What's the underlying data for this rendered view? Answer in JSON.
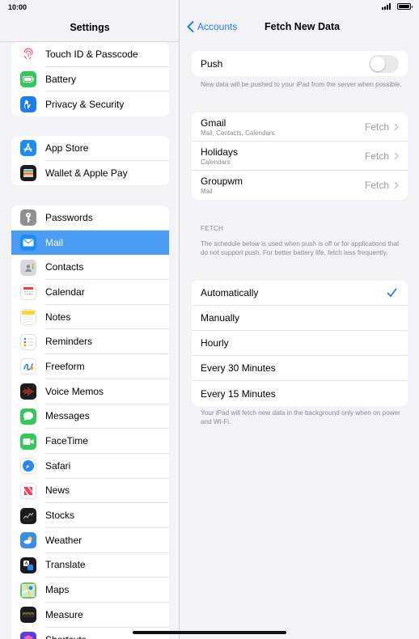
{
  "status": {
    "time": "10:00"
  },
  "sidebar": {
    "title": "Settings",
    "groups": [
      {
        "items": [
          {
            "label": "Touch ID & Passcode",
            "icon": "touch-id-icon",
            "color": "#ffffff"
          },
          {
            "label": "Battery",
            "icon": "battery-icon",
            "color": "#34c759"
          },
          {
            "label": "Privacy & Security",
            "icon": "hand-icon",
            "color": "#1c7cf4"
          }
        ]
      },
      {
        "items": [
          {
            "label": "App Store",
            "icon": "app-store-icon",
            "color": "#1c8cf4"
          },
          {
            "label": "Wallet & Apple Pay",
            "icon": "wallet-icon",
            "color": "#1c1c1e"
          }
        ]
      },
      {
        "items": [
          {
            "label": "Passwords",
            "icon": "key-icon",
            "color": "#8e8e93"
          },
          {
            "label": "Mail",
            "icon": "mail-icon",
            "color": "#1c8cf4",
            "selected": true
          },
          {
            "label": "Contacts",
            "icon": "contacts-icon",
            "color": "#d8d8dc"
          },
          {
            "label": "Calendar",
            "icon": "calendar-icon",
            "color": "#ffffff"
          },
          {
            "label": "Notes",
            "icon": "notes-icon",
            "color": "#ffffff"
          },
          {
            "label": "Reminders",
            "icon": "reminders-icon",
            "color": "#ffffff"
          },
          {
            "label": "Freeform",
            "icon": "freeform-icon",
            "color": "#ffffff"
          },
          {
            "label": "Voice Memos",
            "icon": "voice-memos-icon",
            "color": "#1c1c1e"
          },
          {
            "label": "Messages",
            "icon": "messages-icon",
            "color": "#34c759"
          },
          {
            "label": "FaceTime",
            "icon": "facetime-icon",
            "color": "#34c759"
          },
          {
            "label": "Safari",
            "icon": "safari-icon",
            "color": "#ffffff"
          },
          {
            "label": "News",
            "icon": "news-icon",
            "color": "#ffffff"
          },
          {
            "label": "Stocks",
            "icon": "stocks-icon",
            "color": "#1c1c1e"
          },
          {
            "label": "Weather",
            "icon": "weather-icon",
            "color": "#3a8ee6"
          },
          {
            "label": "Translate",
            "icon": "translate-icon",
            "color": "#1c1c1e"
          },
          {
            "label": "Maps",
            "icon": "maps-icon",
            "color": "#6fc36f"
          },
          {
            "label": "Measure",
            "icon": "measure-icon",
            "color": "#1c1c1e"
          },
          {
            "label": "Shortcuts",
            "icon": "shortcuts-icon",
            "color": "#5b3ee0"
          }
        ]
      }
    ]
  },
  "detail": {
    "back_label": "Accounts",
    "title": "Fetch New Data",
    "push": {
      "label": "Push",
      "enabled": false,
      "note": "New data will be pushed to your iPad from the server when possible."
    },
    "accounts": [
      {
        "name": "Gmail",
        "sub": "Mail, Contacts, Calendars",
        "value": "Fetch"
      },
      {
        "name": "Holidays",
        "sub": "Calendars",
        "value": "Fetch"
      },
      {
        "name": "Groupwm",
        "sub": "Mail",
        "value": "Fetch"
      }
    ],
    "fetch_header": "FETCH",
    "fetch_note": "The schedule below is used when push is off or for applications that do not support push. For better battery life, fetch less frequently.",
    "schedule": [
      {
        "label": "Automatically",
        "checked": true
      },
      {
        "label": "Manually",
        "checked": false
      },
      {
        "label": "Hourly",
        "checked": false
      },
      {
        "label": "Every 30 Minutes",
        "checked": false
      },
      {
        "label": "Every 15 Minutes",
        "checked": false
      }
    ],
    "schedule_note": "Your iPad will fetch new data in the background only when on power and Wi-Fi.",
    "accent": "#1c7cf4"
  }
}
